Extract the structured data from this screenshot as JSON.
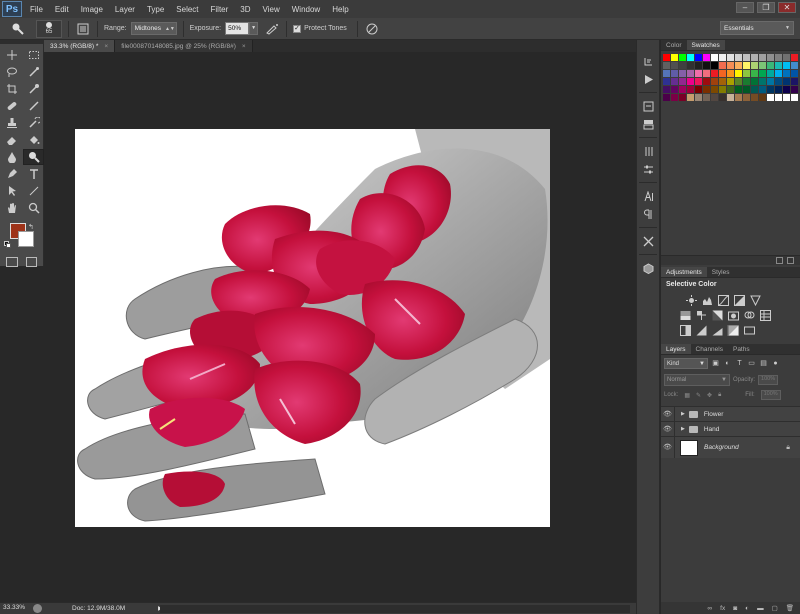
{
  "app": {
    "logo": "Ps"
  },
  "menu": [
    "File",
    "Edit",
    "Image",
    "Layer",
    "Type",
    "Select",
    "Filter",
    "3D",
    "View",
    "Window",
    "Help"
  ],
  "window_controls": [
    "–",
    "❐",
    "✕"
  ],
  "options": {
    "brush_size": "65",
    "range_label": "Range:",
    "range_value": "Midtones",
    "exposure_label": "Exposure:",
    "exposure_value": "50%",
    "protect_tones_label": "Protect Tones",
    "protect_tones_checked": true,
    "workspace": "Essentials"
  },
  "tabs": [
    {
      "label": "33.3% (RGB/8) *",
      "active": true
    },
    {
      "label": "file000870148085.jpg @ 25% (RGB/8#)",
      "active": false
    }
  ],
  "toolbox": {
    "foreground_color": "#9e3319",
    "background_color": "#ffffff",
    "tools": [
      "move-icon",
      "marquee-icon",
      "lasso-icon",
      "quick-select-icon",
      "crop-icon",
      "eyedropper-icon",
      "healing-icon",
      "brush-icon",
      "stamp-icon",
      "history-brush-icon",
      "eraser-icon",
      "bucket-icon",
      "blur-icon",
      "dodge-icon",
      "pen-icon",
      "type-icon",
      "path-select-icon",
      "line-icon",
      "hand-icon",
      "zoom-icon"
    ],
    "selected_tool": "dodge-icon"
  },
  "status": {
    "zoom": "33.33%",
    "doc_info": "Doc: 12.9M/38.0M"
  },
  "panels": {
    "color_tabs": [
      "Color",
      "Swatches"
    ],
    "adjust_tabs": [
      "Adjustments",
      "Styles"
    ],
    "adjust_title": "Selective Color",
    "layers_tabs": [
      "Layers",
      "Channels",
      "Paths"
    ],
    "kind_label": "Kind",
    "blend_mode": "Normal",
    "opacity_label": "Opacity:",
    "opacity_value": "100%",
    "lock_label": "Lock:",
    "fill_label": "Fill:",
    "fill_value": "100%",
    "layers": [
      {
        "name": "Flower",
        "type": "group"
      },
      {
        "name": "Hand",
        "type": "group"
      },
      {
        "name": "Background",
        "type": "background"
      }
    ]
  },
  "swatch_colors": [
    "#ff0000",
    "#ffff00",
    "#00ff00",
    "#00ffff",
    "#0000ff",
    "#ff00ff",
    "#ffffff",
    "#f0f0f0",
    "#e0e0e0",
    "#d0d0d0",
    "#c0c0c0",
    "#b0b0b0",
    "#a0a0a0",
    "#909090",
    "#808080",
    "#707070",
    "#ed1c24",
    "#606060",
    "#505050",
    "#404040",
    "#303030",
    "#202020",
    "#101010",
    "#000000",
    "#f26c4f",
    "#f68e55",
    "#fbaf5c",
    "#fff467",
    "#acd372",
    "#7cc576",
    "#3bb878",
    "#1abbb4",
    "#00bff3",
    "#438ccb",
    "#5574b9",
    "#605ca8",
    "#855fa8",
    "#a763a8",
    "#f06ea9",
    "#f26d7d",
    "#ed1c24",
    "#f26522",
    "#f7941d",
    "#fff200",
    "#8dc63f",
    "#39b54a",
    "#00a651",
    "#00a99d",
    "#00aeef",
    "#0072bc",
    "#0054a6",
    "#2e3192",
    "#662d91",
    "#92278f",
    "#ec008c",
    "#ed145b",
    "#9e0b0f",
    "#a0410d",
    "#a36209",
    "#aba000",
    "#598527",
    "#1a7b30",
    "#007236",
    "#00746b",
    "#0076a3",
    "#004b80",
    "#003471",
    "#1b1464",
    "#440e62",
    "#630460",
    "#9e005d",
    "#9e0039",
    "#790000",
    "#7b2e00",
    "#7d4900",
    "#827b00",
    "#406618",
    "#005e20",
    "#005826",
    "#005952",
    "#005b7f",
    "#003663",
    "#002157",
    "#0d004c",
    "#32004b",
    "#4b0049",
    "#7b0046",
    "#7a0026",
    "#c69c6d",
    "#998675",
    "#736357",
    "#534741",
    "#37302d",
    "#c7b299",
    "#a67c52",
    "#8c6239",
    "#754c24",
    "#603913",
    "#ffffff",
    "#ffffff",
    "#ffffff",
    "#ffffff"
  ]
}
